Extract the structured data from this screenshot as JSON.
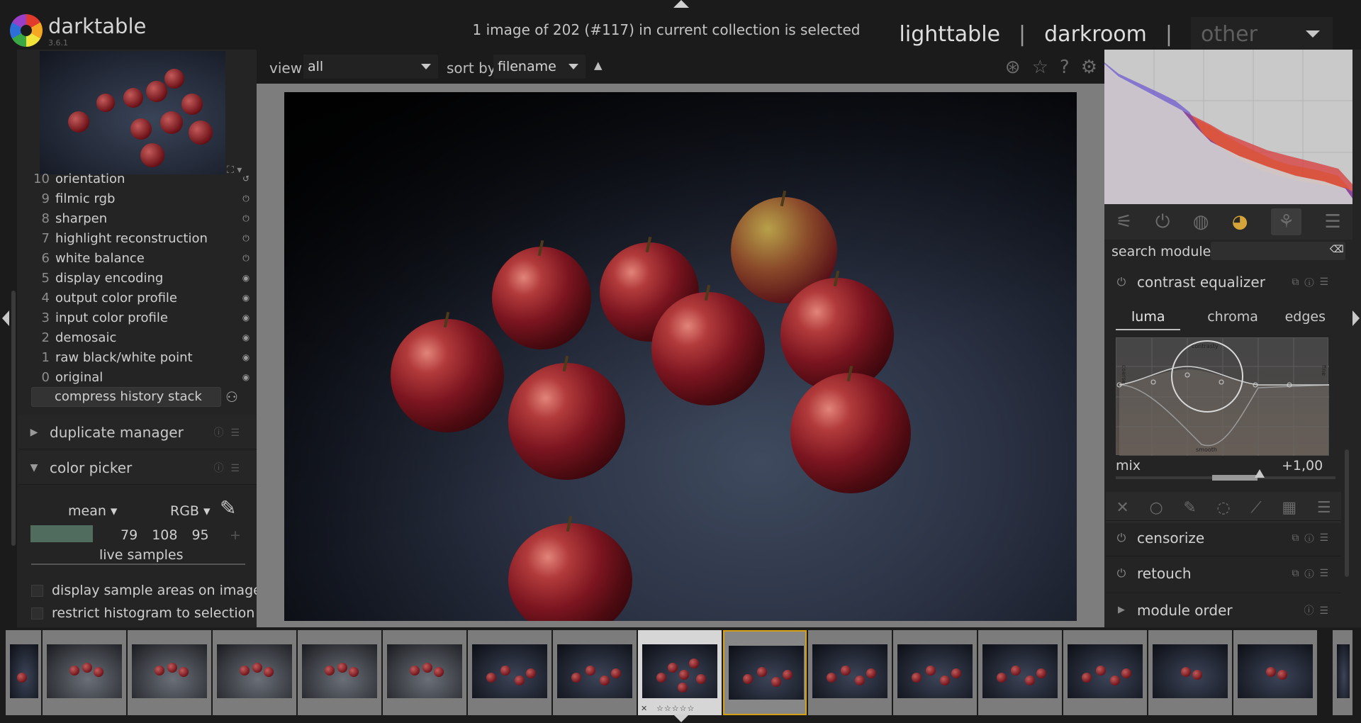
{
  "app": {
    "name": "darktable",
    "version": "3.6.1"
  },
  "header": {
    "status": "1 image of 202 (#117) in current collection is selected",
    "views": {
      "lighttable": "lighttable",
      "darkroom": "darkroom",
      "other": "other",
      "sep": "|"
    }
  },
  "toolbar": {
    "view_label": "view",
    "view_value": "all",
    "sort_label": "sort by",
    "sort_value": "filename",
    "sort_dir": "▲"
  },
  "history": {
    "items": [
      {
        "n": "10",
        "label": "orientation"
      },
      {
        "n": "9",
        "label": "filmic rgb"
      },
      {
        "n": "8",
        "label": "sharpen"
      },
      {
        "n": "7",
        "label": "highlight reconstruction"
      },
      {
        "n": "6",
        "label": "white balance"
      },
      {
        "n": "5",
        "label": "display encoding"
      },
      {
        "n": "4",
        "label": "output color profile"
      },
      {
        "n": "3",
        "label": "input color profile"
      },
      {
        "n": "2",
        "label": "demosaic"
      },
      {
        "n": "1",
        "label": "raw black/white point"
      },
      {
        "n": "0",
        "label": "original"
      }
    ],
    "compress": "compress history stack"
  },
  "left_modules": {
    "duplicate": "duplicate manager",
    "color_picker": "color picker"
  },
  "color_picker": {
    "mode": "mean",
    "space": "RGB",
    "values": [
      "79",
      "108",
      "95"
    ],
    "swatch_color": "#4f6c5f",
    "live_samples": "live samples",
    "opt1": "display sample areas on image",
    "opt2": "restrict histogram to selection"
  },
  "right": {
    "search_label": "search module",
    "module": "contrast equalizer",
    "tabs": [
      "luma",
      "chroma",
      "edges"
    ],
    "graph_labels": {
      "top": "contrasty",
      "bottom": "smooth",
      "left": "coarse",
      "right": "fine"
    },
    "mix_label": "mix",
    "mix_value": "+1,00",
    "censorize": "censorize",
    "retouch": "retouch",
    "module_order": "module order"
  },
  "colors": {
    "accent_hover": "#d4a017",
    "panel": "#242424"
  }
}
